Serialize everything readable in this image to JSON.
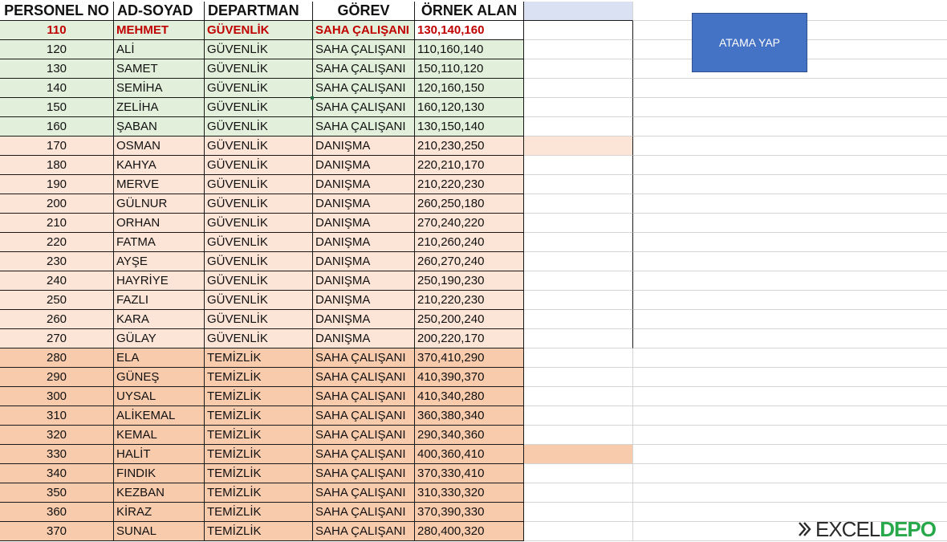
{
  "headers": [
    "PERSONEL NO",
    "AD-SOYAD",
    "DEPARTMAN",
    "GÖREV",
    "ÖRNEK ALAN"
  ],
  "rows": [
    {
      "no": "110",
      "name": "MEHMET",
      "dept": "GÜVENLİK",
      "role": "SAHA ÇALIŞANI",
      "sample": "130,140,160",
      "band": "green"
    },
    {
      "no": "120",
      "name": "ALİ",
      "dept": "GÜVENLİK",
      "role": "SAHA ÇALIŞANI",
      "sample": "110,160,140",
      "band": "green"
    },
    {
      "no": "130",
      "name": "SAMET",
      "dept": "GÜVENLİK",
      "role": "SAHA ÇALIŞANI",
      "sample": "150,110,120",
      "band": "green"
    },
    {
      "no": "140",
      "name": "SEMİHA",
      "dept": "GÜVENLİK",
      "role": "SAHA ÇALIŞANI",
      "sample": "120,160,150",
      "band": "green"
    },
    {
      "no": "150",
      "name": "ZELİHA",
      "dept": "GÜVENLİK",
      "role": "SAHA ÇALIŞANI",
      "sample": "160,120,130",
      "band": "green"
    },
    {
      "no": "160",
      "name": "ŞABAN",
      "dept": "GÜVENLİK",
      "role": "SAHA ÇALIŞANI",
      "sample": "130,150,140",
      "band": "green"
    },
    {
      "no": "170",
      "name": "OSMAN",
      "dept": "GÜVENLİK",
      "role": "DANIŞMA",
      "sample": "210,230,250",
      "band": "pink"
    },
    {
      "no": "180",
      "name": "KAHYA",
      "dept": "GÜVENLİK",
      "role": "DANIŞMA",
      "sample": "220,210,170",
      "band": "pink"
    },
    {
      "no": "190",
      "name": "MERVE",
      "dept": "GÜVENLİK",
      "role": "DANIŞMA",
      "sample": "210,220,230",
      "band": "pink"
    },
    {
      "no": "200",
      "name": "GÜLNUR",
      "dept": "GÜVENLİK",
      "role": "DANIŞMA",
      "sample": "260,250,180",
      "band": "pink"
    },
    {
      "no": "210",
      "name": "ORHAN",
      "dept": "GÜVENLİK",
      "role": "DANIŞMA",
      "sample": "270,240,220",
      "band": "pink"
    },
    {
      "no": "220",
      "name": "FATMA",
      "dept": "GÜVENLİK",
      "role": "DANIŞMA",
      "sample": "210,260,240",
      "band": "pink"
    },
    {
      "no": "230",
      "name": "AYŞE",
      "dept": "GÜVENLİK",
      "role": "DANIŞMA",
      "sample": "260,270,240",
      "band": "pink"
    },
    {
      "no": "240",
      "name": "HAYRİYE",
      "dept": "GÜVENLİK",
      "role": "DANIŞMA",
      "sample": "250,190,230",
      "band": "pink"
    },
    {
      "no": "250",
      "name": "FAZLI",
      "dept": "GÜVENLİK",
      "role": "DANIŞMA",
      "sample": "210,220,230",
      "band": "pink"
    },
    {
      "no": "260",
      "name": "KARA",
      "dept": "GÜVENLİK",
      "role": "DANIŞMA",
      "sample": "250,200,240",
      "band": "pink"
    },
    {
      "no": "270",
      "name": "GÜLAY",
      "dept": "GÜVENLİK",
      "role": "DANIŞMA",
      "sample": "200,220,170",
      "band": "pink"
    },
    {
      "no": "280",
      "name": "ELA",
      "dept": "TEMİZLİK",
      "role": "SAHA ÇALIŞANI",
      "sample": "370,410,290",
      "band": "orange"
    },
    {
      "no": "290",
      "name": "GÜNEŞ",
      "dept": "TEMİZLİK",
      "role": "SAHA ÇALIŞANI",
      "sample": "410,390,370",
      "band": "orange"
    },
    {
      "no": "300",
      "name": "UYSAL",
      "dept": "TEMİZLİK",
      "role": "SAHA ÇALIŞANI",
      "sample": "410,340,280",
      "band": "orange"
    },
    {
      "no": "310",
      "name": "ALİKEMAL",
      "dept": "TEMİZLİK",
      "role": "SAHA ÇALIŞANI",
      "sample": "360,380,340",
      "band": "orange"
    },
    {
      "no": "320",
      "name": "KEMAL",
      "dept": "TEMİZLİK",
      "role": "SAHA ÇALIŞANI",
      "sample": "290,340,360",
      "band": "orange"
    },
    {
      "no": "330",
      "name": "HALİT",
      "dept": "TEMİZLİK",
      "role": "SAHA ÇALIŞANI",
      "sample": "400,360,410",
      "band": "orange"
    },
    {
      "no": "340",
      "name": "FINDIK",
      "dept": "TEMİZLİK",
      "role": "SAHA ÇALIŞANI",
      "sample": "370,330,410",
      "band": "orange"
    },
    {
      "no": "350",
      "name": "KEZBAN",
      "dept": "TEMİZLİK",
      "role": "SAHA ÇALIŞANI",
      "sample": "310,330,320",
      "band": "orange"
    },
    {
      "no": "360",
      "name": "KİRAZ",
      "dept": "TEMİZLİK",
      "role": "SAHA ÇALIŞANI",
      "sample": "370,390,330",
      "band": "orange"
    },
    {
      "no": "370",
      "name": "SUNAL",
      "dept": "TEMİZLİK",
      "role": "SAHA ÇALIŞANI",
      "sample": "280,400,320",
      "band": "orange"
    }
  ],
  "button": {
    "label": "ATAMA YAP"
  },
  "logo": {
    "part1": "EXCEL",
    "part2": "DEPO"
  },
  "colors": {
    "header_fill": "#d9e1f2",
    "green_band": "#e2efda",
    "pink_band": "#fce4d6",
    "orange_band": "#f8cbad",
    "highlight_text": "#c00000",
    "button_fill": "#4472c4"
  }
}
